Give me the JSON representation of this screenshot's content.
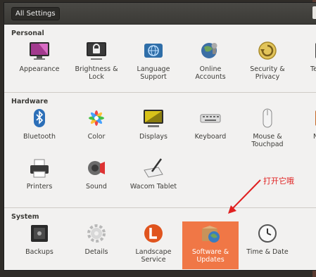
{
  "window": {
    "back_button": "All Settings"
  },
  "sections": [
    {
      "title": "Personal",
      "items": [
        "Appearance",
        "Brightness &\nLock",
        "Language\nSupport",
        "Online\nAccounts",
        "Security &\nPrivacy",
        "Te"
      ]
    },
    {
      "title": "Hardware",
      "items": [
        "Bluetooth",
        "Color",
        "Displays",
        "Keyboard",
        "Mouse &\nTouchpad",
        "N",
        "Printers",
        "Sound",
        "Wacom Tablet"
      ]
    },
    {
      "title": "System",
      "items": [
        "Backups",
        "Details",
        "Landscape\nService",
        "Software &\nUpdates",
        "Time & Date"
      ]
    }
  ],
  "selected_item": "Software & Updates",
  "annotation": "打开它哦",
  "colors": {
    "accent": "#f07746",
    "annotation": "#e02020"
  }
}
